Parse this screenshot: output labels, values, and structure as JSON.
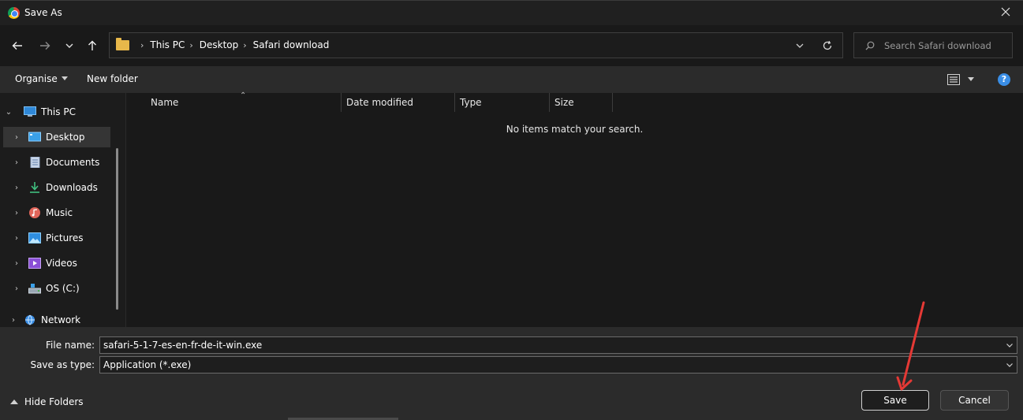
{
  "window": {
    "title": "Save As"
  },
  "address": {
    "breadcrumbs": [
      "This PC",
      "Desktop",
      "Safari download"
    ]
  },
  "search": {
    "placeholder": "Search Safari download"
  },
  "toolbar": {
    "organise_label": "Organise",
    "new_folder_label": "New folder"
  },
  "nav": {
    "items": [
      {
        "label": "This PC",
        "icon": "monitor-icon"
      },
      {
        "label": "Desktop",
        "icon": "desktop-icon",
        "selected": true
      },
      {
        "label": "Documents",
        "icon": "documents-icon"
      },
      {
        "label": "Downloads",
        "icon": "download-icon"
      },
      {
        "label": "Music",
        "icon": "music-icon"
      },
      {
        "label": "Pictures",
        "icon": "pictures-icon"
      },
      {
        "label": "Videos",
        "icon": "videos-icon"
      },
      {
        "label": "OS (C:)",
        "icon": "drive-icon"
      },
      {
        "label": "Network",
        "icon": "network-icon"
      }
    ]
  },
  "filelist": {
    "columns": [
      "Name",
      "Date modified",
      "Type",
      "Size"
    ],
    "empty_message": "No items match your search."
  },
  "form": {
    "file_name_label": "File name:",
    "file_name_value": "safari-5-1-7-es-en-fr-de-it-win.exe",
    "save_type_label": "Save as type:",
    "save_type_value": "Application (*.exe)"
  },
  "footer": {
    "hide_folders_label": "Hide Folders",
    "save_label": "Save",
    "cancel_label": "Cancel"
  },
  "colors": {
    "accent": "#3a8ee6",
    "annotation": "#e53935",
    "folder": "#e8b84a"
  }
}
